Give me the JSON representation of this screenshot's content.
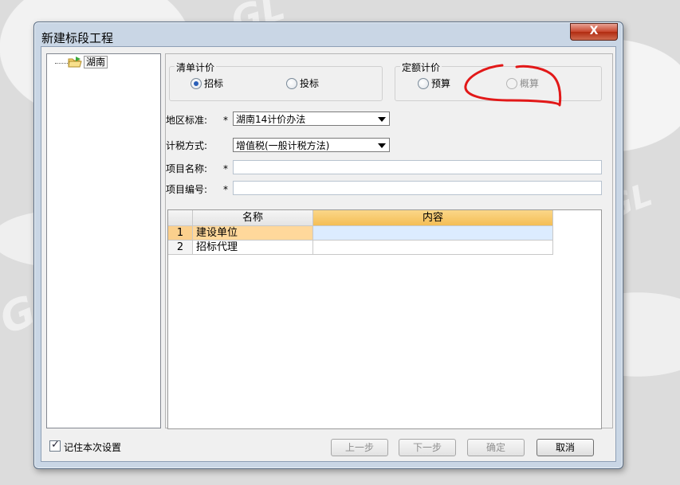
{
  "window": {
    "title": "新建标段工程",
    "close_label": "X"
  },
  "tree": {
    "root_label": "湖南"
  },
  "qingdan_group": {
    "title": "清单计价",
    "options": [
      "招标",
      "投标"
    ],
    "selected": "招标"
  },
  "dinge_group": {
    "title": "定额计价",
    "options": [
      "预算",
      "概算"
    ],
    "disabled": [
      "概算"
    ]
  },
  "form": {
    "region_label": "地区标准:",
    "region_value": "湖南14计价办法",
    "tax_label": "计税方式:",
    "tax_value": "增值税(一般计税方法)",
    "project_name_label": "项目名称:",
    "project_code_label": "项目编号:",
    "required_mark": "*"
  },
  "grid": {
    "headers": [
      "名称",
      "内容"
    ],
    "rows": [
      {
        "no": "1",
        "name": "建设单位",
        "content": ""
      },
      {
        "no": "2",
        "name": "招标代理",
        "content": ""
      }
    ]
  },
  "footer": {
    "remember_label": "记住本次设置",
    "remember_checked": true,
    "prev_label": "上一步",
    "next_label": "下一步",
    "ok_label": "确定",
    "cancel_label": "取消"
  },
  "colors": {
    "annotation": "#e21818",
    "selected_row": "#ffd89b",
    "active_header": "#f4be55"
  }
}
